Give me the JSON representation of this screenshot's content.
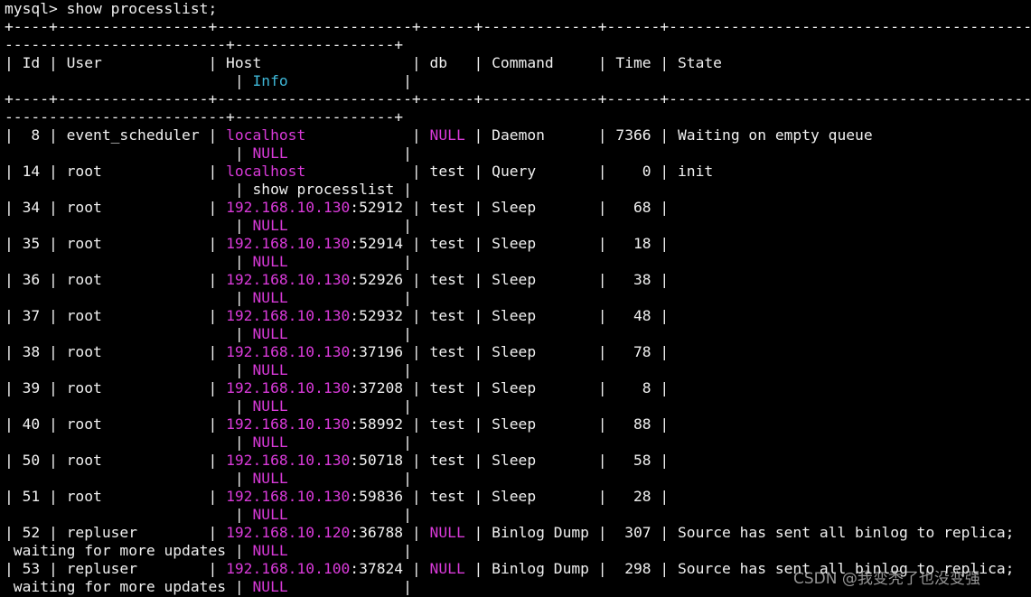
{
  "colors": {
    "background": "#000000",
    "text": "#f0f0f0",
    "highlight_magenta": "#d93ad9",
    "highlight_cyan": "#3fb8d8"
  },
  "terminal": {
    "lines": [
      {
        "name": "command-prompt-line",
        "segs": [
          [
            "mysql> show processlist;",
            ""
          ]
        ]
      },
      {
        "name": "table-border-line",
        "segs": [
          [
            "+----+-----------------+----------------------+------+-------------+------+-----------------------------------------",
            ""
          ]
        ]
      },
      {
        "name": "table-border-line",
        "segs": [
          [
            "-------------------------+------------------+",
            ""
          ]
        ]
      },
      {
        "name": "table-header-line",
        "segs": [
          [
            "| Id | User            | Host                 | db   | Command     | Time | State",
            ""
          ]
        ]
      },
      {
        "name": "table-header-line",
        "segs": [
          [
            "                          | ",
            ""
          ],
          [
            "Info",
            "cyan"
          ],
          [
            "             |",
            ""
          ]
        ]
      },
      {
        "name": "table-border-line",
        "segs": [
          [
            "+----+-----------------+----------------------+------+-------------+------+-----------------------------------------",
            ""
          ]
        ]
      },
      {
        "name": "table-border-line",
        "segs": [
          [
            "-------------------------+------------------+",
            ""
          ]
        ]
      },
      {
        "name": "table-row-line",
        "segs": [
          [
            "|  8 | event_scheduler | ",
            ""
          ],
          [
            "localhost",
            "mag"
          ],
          [
            "            | ",
            ""
          ],
          [
            "NULL",
            "mag"
          ],
          [
            " | Daemon      | 7366 | Waiting on empty queue",
            ""
          ]
        ]
      },
      {
        "name": "table-row-line",
        "segs": [
          [
            "                          | ",
            ""
          ],
          [
            "NULL",
            "mag"
          ],
          [
            "             |",
            ""
          ]
        ]
      },
      {
        "name": "table-row-line",
        "segs": [
          [
            "| 14 | root            | ",
            ""
          ],
          [
            "localhost",
            "mag"
          ],
          [
            "            | test | Query       |    0 | init",
            ""
          ]
        ]
      },
      {
        "name": "table-row-line",
        "segs": [
          [
            "                          | show processlist |",
            ""
          ]
        ]
      },
      {
        "name": "table-row-line",
        "segs": [
          [
            "| 34 | root            | ",
            ""
          ],
          [
            "192.168.10.130",
            "mag"
          ],
          [
            ":52912 | test | Sleep       |   68 |",
            ""
          ]
        ]
      },
      {
        "name": "table-row-line",
        "segs": [
          [
            "                          | ",
            ""
          ],
          [
            "NULL",
            "mag"
          ],
          [
            "             |",
            ""
          ]
        ]
      },
      {
        "name": "table-row-line",
        "segs": [
          [
            "| 35 | root            | ",
            ""
          ],
          [
            "192.168.10.130",
            "mag"
          ],
          [
            ":52914 | test | Sleep       |   18 |",
            ""
          ]
        ]
      },
      {
        "name": "table-row-line",
        "segs": [
          [
            "                          | ",
            ""
          ],
          [
            "NULL",
            "mag"
          ],
          [
            "             |",
            ""
          ]
        ]
      },
      {
        "name": "table-row-line",
        "segs": [
          [
            "| 36 | root            | ",
            ""
          ],
          [
            "192.168.10.130",
            "mag"
          ],
          [
            ":52926 | test | Sleep       |   38 |",
            ""
          ]
        ]
      },
      {
        "name": "table-row-line",
        "segs": [
          [
            "                          | ",
            ""
          ],
          [
            "NULL",
            "mag"
          ],
          [
            "             |",
            ""
          ]
        ]
      },
      {
        "name": "table-row-line",
        "segs": [
          [
            "| 37 | root            | ",
            ""
          ],
          [
            "192.168.10.130",
            "mag"
          ],
          [
            ":52932 | test | Sleep       |   48 |",
            ""
          ]
        ]
      },
      {
        "name": "table-row-line",
        "segs": [
          [
            "                          | ",
            ""
          ],
          [
            "NULL",
            "mag"
          ],
          [
            "             |",
            ""
          ]
        ]
      },
      {
        "name": "table-row-line",
        "segs": [
          [
            "| 38 | root            | ",
            ""
          ],
          [
            "192.168.10.130",
            "mag"
          ],
          [
            ":37196 | test | Sleep       |   78 |",
            ""
          ]
        ]
      },
      {
        "name": "table-row-line",
        "segs": [
          [
            "                          | ",
            ""
          ],
          [
            "NULL",
            "mag"
          ],
          [
            "             |",
            ""
          ]
        ]
      },
      {
        "name": "table-row-line",
        "segs": [
          [
            "| 39 | root            | ",
            ""
          ],
          [
            "192.168.10.130",
            "mag"
          ],
          [
            ":37208 | test | Sleep       |    8 |",
            ""
          ]
        ]
      },
      {
        "name": "table-row-line",
        "segs": [
          [
            "                          | ",
            ""
          ],
          [
            "NULL",
            "mag"
          ],
          [
            "             |",
            ""
          ]
        ]
      },
      {
        "name": "table-row-line",
        "segs": [
          [
            "| 40 | root            | ",
            ""
          ],
          [
            "192.168.10.130",
            "mag"
          ],
          [
            ":58992 | test | Sleep       |   88 |",
            ""
          ]
        ]
      },
      {
        "name": "table-row-line",
        "segs": [
          [
            "                          | ",
            ""
          ],
          [
            "NULL",
            "mag"
          ],
          [
            "             |",
            ""
          ]
        ]
      },
      {
        "name": "table-row-line",
        "segs": [
          [
            "| 50 | root            | ",
            ""
          ],
          [
            "192.168.10.130",
            "mag"
          ],
          [
            ":50718 | test | Sleep       |   58 |",
            ""
          ]
        ]
      },
      {
        "name": "table-row-line",
        "segs": [
          [
            "                          | ",
            ""
          ],
          [
            "NULL",
            "mag"
          ],
          [
            "             |",
            ""
          ]
        ]
      },
      {
        "name": "table-row-line",
        "segs": [
          [
            "| 51 | root            | ",
            ""
          ],
          [
            "192.168.10.130",
            "mag"
          ],
          [
            ":59836 | test | Sleep       |   28 |",
            ""
          ]
        ]
      },
      {
        "name": "table-row-line",
        "segs": [
          [
            "                          | ",
            ""
          ],
          [
            "NULL",
            "mag"
          ],
          [
            "             |",
            ""
          ]
        ]
      },
      {
        "name": "table-row-line",
        "segs": [
          [
            "| 52 | repluser        | ",
            ""
          ],
          [
            "192.168.10.120",
            "mag"
          ],
          [
            ":36788 | ",
            ""
          ],
          [
            "NULL",
            "mag"
          ],
          [
            " | Binlog Dump |  307 | Source has sent all binlog to replica;",
            ""
          ]
        ]
      },
      {
        "name": "table-row-line",
        "segs": [
          [
            " waiting for more updates | ",
            ""
          ],
          [
            "NULL",
            "mag"
          ],
          [
            "             |",
            ""
          ]
        ]
      },
      {
        "name": "table-row-line",
        "segs": [
          [
            "| 53 | repluser        | ",
            ""
          ],
          [
            "192.168.10.100",
            "mag"
          ],
          [
            ":37824 | ",
            ""
          ],
          [
            "NULL",
            "mag"
          ],
          [
            " | Binlog Dump |  298 | Source has sent all binlog to replica;",
            ""
          ]
        ]
      },
      {
        "name": "table-row-line",
        "segs": [
          [
            " waiting for more updates | ",
            ""
          ],
          [
            "NULL",
            "mag"
          ],
          [
            "             |",
            ""
          ]
        ]
      }
    ]
  },
  "watermark": {
    "text": "CSDN @我变秃了也没变强"
  }
}
